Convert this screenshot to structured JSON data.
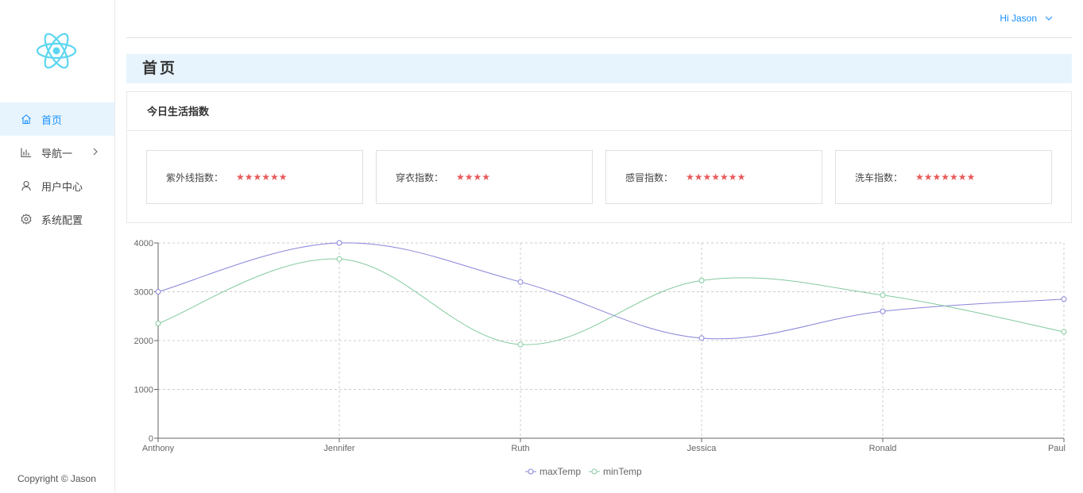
{
  "sidebar": {
    "items": [
      {
        "label": "首页",
        "icon": "home-icon",
        "active": true
      },
      {
        "label": "导航一",
        "icon": "bar-chart-icon",
        "active": false
      },
      {
        "label": "用户中心",
        "icon": "user-icon",
        "active": false
      },
      {
        "label": "系统配置",
        "icon": "settings-icon",
        "active": false
      }
    ],
    "copyright": "Copyright © Jason"
  },
  "header": {
    "user_greeting": "Hi Jason"
  },
  "page": {
    "title": "首页"
  },
  "card": {
    "title": "今日生活指数",
    "indices": [
      {
        "label": "紫外线指数：",
        "stars": "★★★★★★",
        "rating": 6
      },
      {
        "label": "穿衣指数：",
        "stars": "★★★★",
        "rating": 4
      },
      {
        "label": "感冒指数：",
        "stars": "★★★★★★★",
        "rating": 7
      },
      {
        "label": "洗车指数：",
        "stars": "★★★★★★★",
        "rating": 7
      }
    ]
  },
  "colors": {
    "accent": "#1890ff",
    "star": "#e85a5a",
    "maxTemp": "#8884d8",
    "minTemp": "#82ca9d"
  },
  "chart_data": {
    "type": "line",
    "categories": [
      "Anthony",
      "Jennifer",
      "Ruth",
      "Jessica",
      "Ronald",
      "Paul"
    ],
    "series": [
      {
        "name": "maxTemp",
        "values": [
          3000,
          4000,
          3200,
          2050,
          2600,
          2850
        ]
      },
      {
        "name": "minTemp",
        "values": [
          2350,
          3670,
          1920,
          3230,
          2930,
          2180
        ]
      }
    ],
    "ylim": [
      0,
      4000
    ],
    "yticks": [
      0,
      1000,
      2000,
      3000,
      4000
    ],
    "grid": true,
    "legend": "bottom-center"
  }
}
